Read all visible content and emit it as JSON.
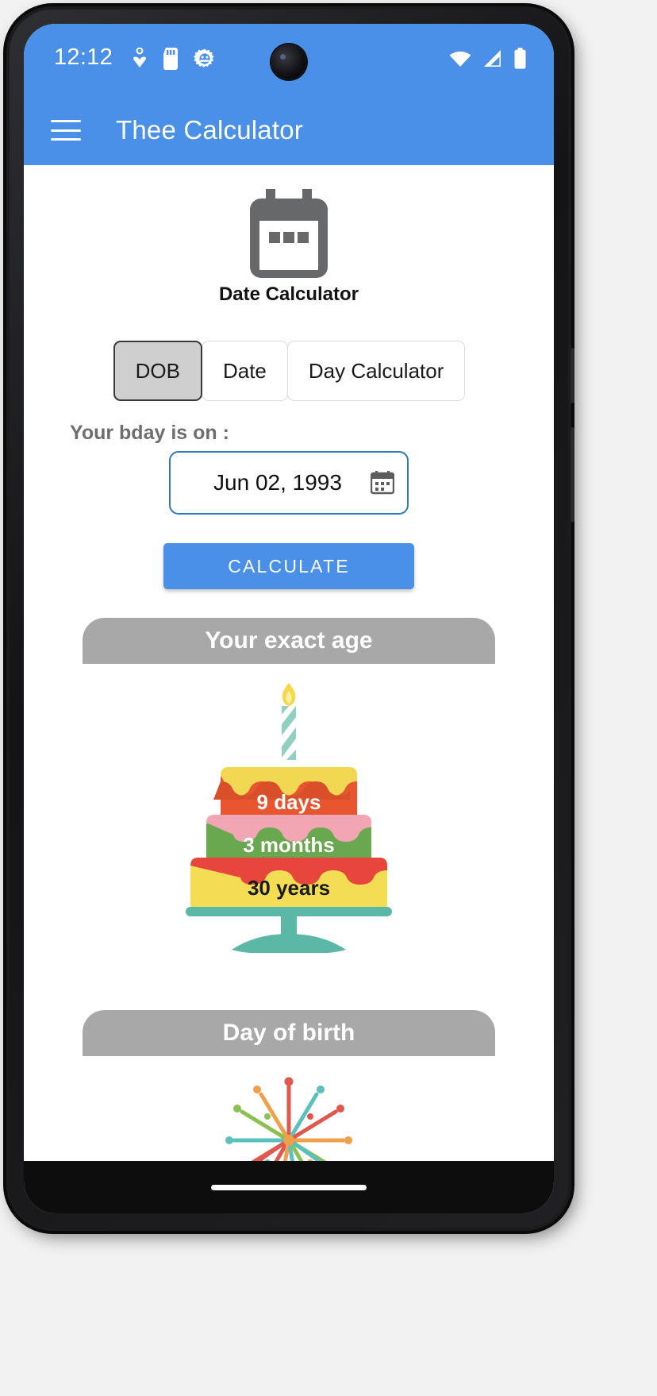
{
  "status_bar": {
    "time": "12:12",
    "left_icons": [
      "download-heart-icon",
      "sd-card-icon",
      "android-gear-icon"
    ],
    "right_icons": [
      "wifi-icon",
      "cellular-signal-icon",
      "battery-icon"
    ]
  },
  "app_bar": {
    "menu_icon": "hamburger-menu-icon",
    "title": "Thee Calculator"
  },
  "page": {
    "icon": "calendar-icon",
    "title": "Date Calculator"
  },
  "segments": {
    "selected": "DOB",
    "options": [
      {
        "label": "DOB",
        "selected": true
      },
      {
        "label": "Date",
        "selected": false
      },
      {
        "label": "Day Calculator",
        "selected": false
      }
    ]
  },
  "date_input": {
    "label": "Your bday is on :",
    "value": "Jun 02, 1993",
    "picker_icon": "calendar-picker-icon"
  },
  "actions": {
    "calculate_label": "CALCULATE"
  },
  "results": {
    "age_banner": "Your exact age",
    "cake": {
      "days": "9 days",
      "months": "3 months",
      "years": "30 years"
    },
    "birthday_banner": "Day of birth",
    "fireworks_icon": "fireworks-icon"
  },
  "colors": {
    "primary": "#4a90e8",
    "banner_gray": "#a8a8a8",
    "field_border": "#2f79bd",
    "cake_top": "#e8562f",
    "cake_middle": "#6aa84f",
    "cake_bottom": "#f2dd55",
    "stand": "#5cb8a6"
  },
  "navigation": {
    "gesture_pill": "home-gesture-pill"
  }
}
